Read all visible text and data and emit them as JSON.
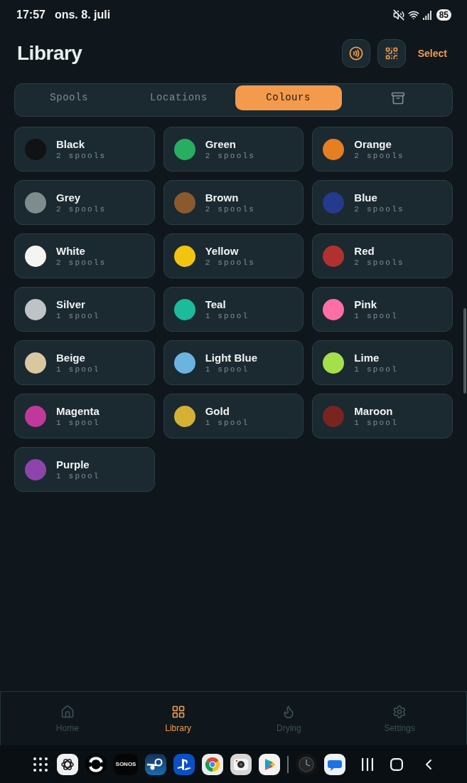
{
  "status_bar": {
    "time": "17:57",
    "date": "ons. 8. juli",
    "battery": "85"
  },
  "header": {
    "title": "Library",
    "select_label": "Select"
  },
  "tabs": [
    {
      "kind": "label",
      "label": "Spools",
      "selected": false
    },
    {
      "kind": "label",
      "label": "Locations",
      "selected": false
    },
    {
      "kind": "label",
      "label": "Colours",
      "selected": true
    },
    {
      "kind": "icon",
      "selected": false
    }
  ],
  "colours": [
    {
      "name": "Black",
      "count": "2 spools",
      "color": "#111214"
    },
    {
      "name": "Green",
      "count": "2 spools",
      "color": "#27ae60"
    },
    {
      "name": "Orange",
      "count": "2 spools",
      "color": "#e67e22"
    },
    {
      "name": "Grey",
      "count": "2 spools",
      "color": "#7f8c8d"
    },
    {
      "name": "Brown",
      "count": "2 spools",
      "color": "#8a5a2e"
    },
    {
      "name": "Blue",
      "count": "2 spools",
      "color": "#233a8f"
    },
    {
      "name": "White",
      "count": "2 spools",
      "color": "#f4f4f0"
    },
    {
      "name": "Yellow",
      "count": "2 spools",
      "color": "#f1c40f"
    },
    {
      "name": "Red",
      "count": "2 spools",
      "color": "#b33030"
    },
    {
      "name": "Silver",
      "count": "1 spool",
      "color": "#bdc3c7"
    },
    {
      "name": "Teal",
      "count": "1 spool",
      "color": "#1abc9c"
    },
    {
      "name": "Pink",
      "count": "1 spool",
      "color": "#ff6fa5"
    },
    {
      "name": "Beige",
      "count": "1 spool",
      "color": "#d9c7a0"
    },
    {
      "name": "Light Blue",
      "count": "1 spool",
      "color": "#6cb4e0"
    },
    {
      "name": "Lime",
      "count": "1 spool",
      "color": "#a4e04a"
    },
    {
      "name": "Magenta",
      "count": "1 spool",
      "color": "#c0399a"
    },
    {
      "name": "Gold",
      "count": "1 spool",
      "color": "#d4b035"
    },
    {
      "name": "Maroon",
      "count": "1 spool",
      "color": "#7a2420"
    },
    {
      "name": "Purple",
      "count": "1 spool",
      "color": "#8e44ad"
    }
  ],
  "bottom_nav": [
    {
      "label": "Home",
      "selected": false
    },
    {
      "label": "Library",
      "selected": true
    },
    {
      "label": "Drying",
      "selected": false
    },
    {
      "label": "Settings",
      "selected": false
    }
  ],
  "taskbar": {
    "wordmark": "SONOS"
  }
}
